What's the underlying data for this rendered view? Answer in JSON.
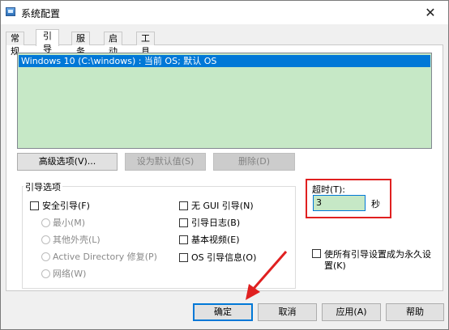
{
  "window": {
    "title": "系统配置",
    "close_glyph": "✕"
  },
  "tabs": [
    {
      "label": "常规"
    },
    {
      "label": "引导"
    },
    {
      "label": "服务"
    },
    {
      "label": "启动"
    },
    {
      "label": "工具"
    }
  ],
  "active_tab": "引导",
  "os_list": {
    "items": [
      "Windows 10 (C:\\windows) : 当前 OS; 默认 OS"
    ],
    "selected_index": 0
  },
  "list_buttons": {
    "advanced": "高级选项(V)...",
    "set_default": "设为默认值(S)",
    "delete": "删除(D)"
  },
  "boot_options": {
    "group_title": "引导选项",
    "safe_boot": "安全引导(F)",
    "radios": [
      "最小(M)",
      "其他外壳(L)",
      "Active Directory 修复(P)",
      "网络(W)"
    ],
    "no_gui": "无 GUI 引导(N)",
    "boot_log": "引导日志(B)",
    "base_video": "基本视频(E)",
    "os_boot_info": "OS 引导信息(O)"
  },
  "timeout": {
    "label": "超时(T):",
    "value": "3",
    "unit": "秒"
  },
  "persist": {
    "label": "使所有引导设置成为永久设置(K)"
  },
  "footer_buttons": {
    "ok": "确定",
    "cancel": "取消",
    "apply": "应用(A)",
    "help": "帮助"
  },
  "colors": {
    "accent": "#0078d7",
    "list_bg": "#c6e8c6",
    "highlight": "#e02020"
  }
}
